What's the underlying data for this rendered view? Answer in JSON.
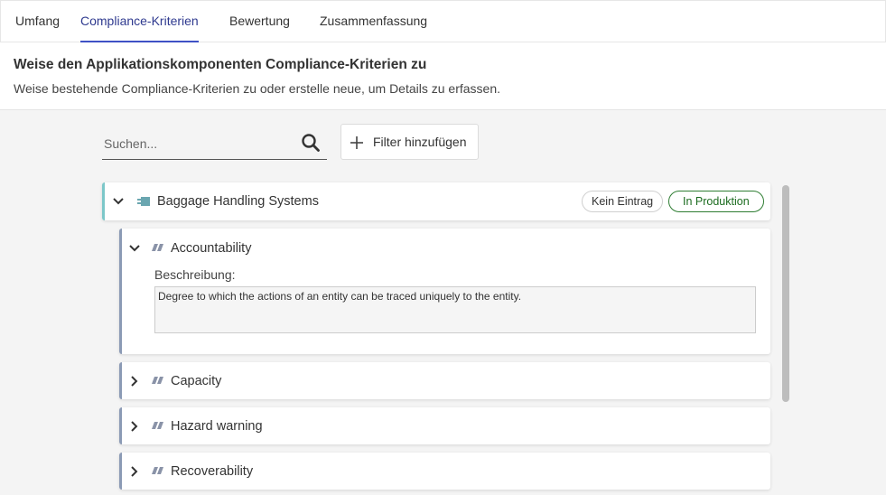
{
  "tabs": [
    {
      "label": "Umfang",
      "active": false
    },
    {
      "label": "Compliance-Kriterien",
      "active": true
    },
    {
      "label": "Bewertung",
      "active": false
    },
    {
      "label": "Zusammenfassung",
      "active": false
    }
  ],
  "header": {
    "title": "Weise den Applikationskomponenten Compliance-Kriterien zu",
    "subtitle": "Weise bestehende Compliance-Kriterien zu oder erstelle neue, um Details zu erfassen."
  },
  "search": {
    "placeholder": "Suchen...",
    "value": "",
    "icon": "search-icon"
  },
  "filter_button": {
    "label": "Filter hinzufügen",
    "icon": "plus-icon"
  },
  "component": {
    "name": "Baggage Handling Systems",
    "icon": "application-component-icon",
    "expanded": true,
    "badges": [
      {
        "label": "Kein Eintrag",
        "style": "neutral"
      },
      {
        "label": "In Produktion",
        "style": "success",
        "color": "#2e7d32"
      }
    ],
    "accent_color": "#7cc7c9"
  },
  "criteria": [
    {
      "name": "Accountability",
      "icon": "compliance-criterion-icon",
      "expanded": true,
      "description_label": "Beschreibung:",
      "description": "Degree to which the actions of an entity can be traced uniquely to the entity."
    },
    {
      "name": "Capacity",
      "icon": "compliance-criterion-icon",
      "expanded": false
    },
    {
      "name": "Hazard warning",
      "icon": "compliance-criterion-icon",
      "expanded": false
    },
    {
      "name": "Recoverability",
      "icon": "compliance-criterion-icon",
      "expanded": false
    }
  ],
  "colors": {
    "active_tab_underline": "#3f51c5",
    "criterion_accent": "#8b9ab5",
    "background": "#f4f4f4"
  }
}
